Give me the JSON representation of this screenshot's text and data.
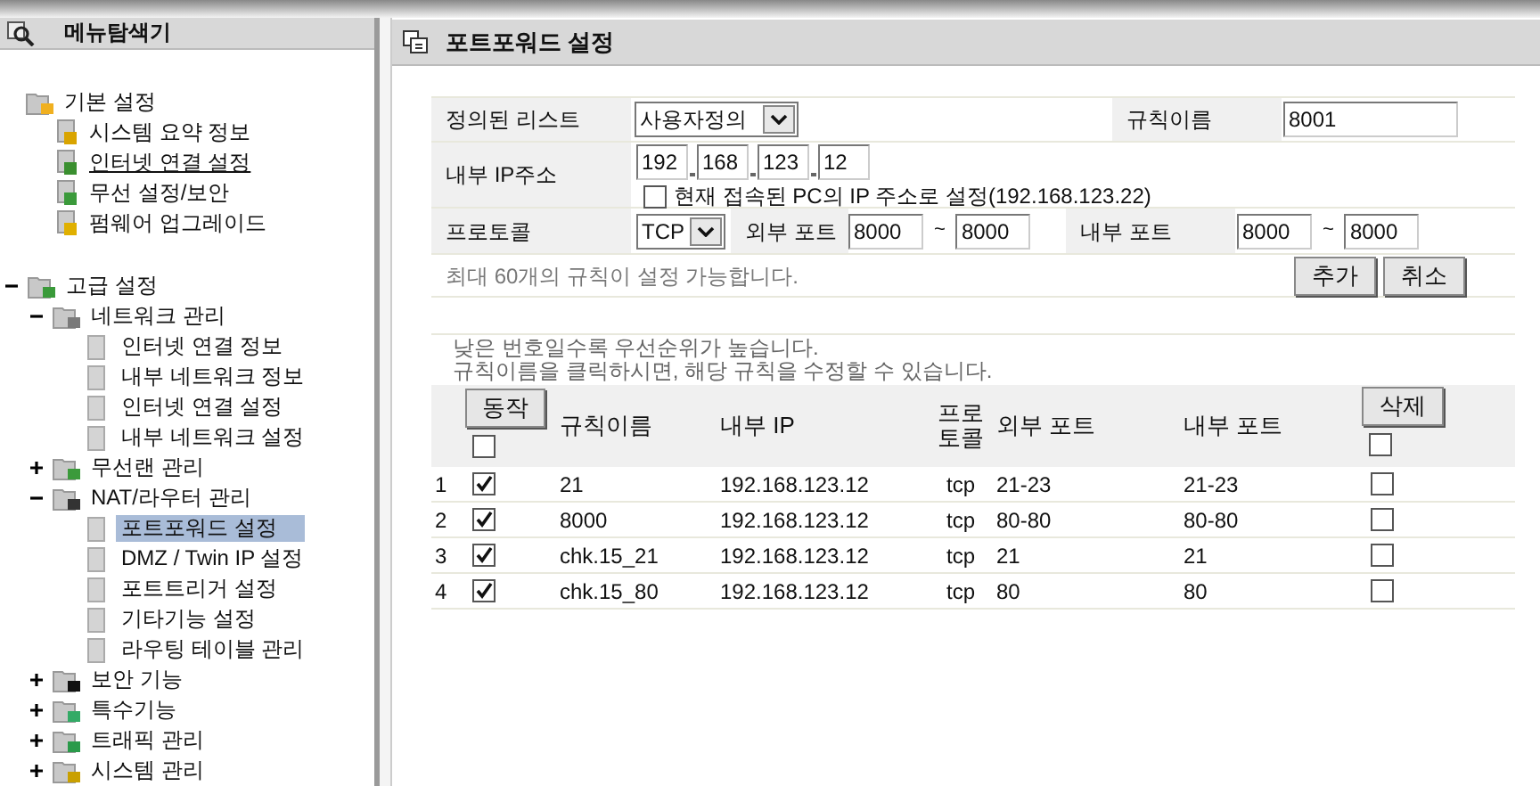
{
  "sidebar": {
    "title": "메뉴탐색기",
    "basic": {
      "label": "기본 설정",
      "items": [
        {
          "label": "시스템 요약 정보",
          "hovered": false
        },
        {
          "label": "인터넷 연결 설정",
          "hovered": true
        },
        {
          "label": "무선 설정/보안",
          "hovered": false
        },
        {
          "label": "펌웨어 업그레이드",
          "hovered": false
        }
      ]
    },
    "advanced": {
      "label": "고급 설정",
      "expanded": true,
      "children": [
        {
          "label": "네트워크 관리",
          "expanded": true,
          "children": [
            {
              "label": "인터넷 연결 정보",
              "selected": false
            },
            {
              "label": "내부 네트워크 정보",
              "selected": false
            },
            {
              "label": "인터넷 연결 설정",
              "selected": false
            },
            {
              "label": "내부 네트워크 설정",
              "selected": false
            }
          ]
        },
        {
          "label": "무선랜 관리",
          "expanded": false
        },
        {
          "label": "NAT/라우터 관리",
          "expanded": true,
          "children": [
            {
              "label": "포트포워드 설정",
              "selected": true
            },
            {
              "label": "DMZ / Twin IP 설정",
              "selected": false
            },
            {
              "label": "포트트리거 설정",
              "selected": false
            },
            {
              "label": "기타기능 설정",
              "selected": false
            },
            {
              "label": "라우팅 테이블 관리",
              "selected": false
            }
          ]
        },
        {
          "label": "보안 기능",
          "expanded": false
        },
        {
          "label": "특수기능",
          "expanded": false
        },
        {
          "label": "트래픽 관리",
          "expanded": false
        },
        {
          "label": "시스템 관리",
          "expanded": false
        }
      ]
    }
  },
  "panel": {
    "title": "포트포워드 설정",
    "form": {
      "predefined": {
        "label": "정의된 리스트",
        "value": "사용자정의"
      },
      "rule_name": {
        "label": "규칙이름",
        "value": "8001"
      },
      "internal_ip": {
        "label": "내부 IP주소",
        "octets": [
          "192",
          "168",
          "123",
          "12"
        ],
        "use_current": {
          "checked": false,
          "label": "현재 접속된 PC의 IP 주소로 설정(192.168.123.22)"
        }
      },
      "protocol": {
        "label": "프로토콜",
        "value": "TCP"
      },
      "external_port": {
        "label": "외부 포트",
        "from": "8000",
        "separator": "~",
        "to": "8000"
      },
      "internal_port": {
        "label": "내부 포트",
        "from": "8000",
        "separator": "~",
        "to": "8000"
      },
      "note": "최대 60개의 규칙이 설정 가능합니다.",
      "buttons": [
        "추가",
        "취소"
      ]
    },
    "table": {
      "notes": [
        "낮은 번호일수록 우선순위가 높습니다.",
        "규칙이름을 클릭하시면, 해당 규칙을 수정할 수 있습니다."
      ],
      "action_button": "동작",
      "action_all_checked": false,
      "columns": [
        "규칙이름",
        "내부 IP",
        "프로토콜",
        "외부 포트",
        "내부 포트"
      ],
      "delete_button": "삭제",
      "delete_all_checked": false,
      "rows": [
        {
          "no": "1",
          "enabled": true,
          "name": "21",
          "ip": "192.168.123.12",
          "protocol": "tcp",
          "external": "21-23",
          "internal": "21-23",
          "delete_checked": false
        },
        {
          "no": "2",
          "enabled": true,
          "name": "8000",
          "ip": "192.168.123.12",
          "protocol": "tcp",
          "external": "80-80",
          "internal": "80-80",
          "delete_checked": false
        },
        {
          "no": "3",
          "enabled": true,
          "name": "chk.15_21",
          "ip": "192.168.123.12",
          "protocol": "tcp",
          "external": "21",
          "internal": "21",
          "delete_checked": false
        },
        {
          "no": "4",
          "enabled": true,
          "name": "chk.15_80",
          "ip": "192.168.123.12",
          "protocol": "tcp",
          "external": "80",
          "internal": "80",
          "delete_checked": false
        }
      ]
    }
  }
}
